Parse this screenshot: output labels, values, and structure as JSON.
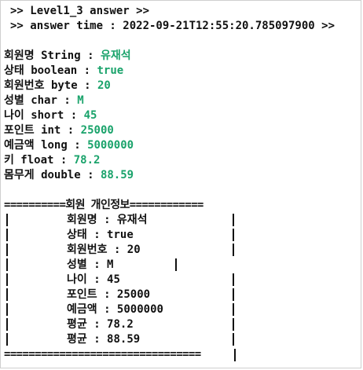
{
  "header": {
    "level": ">> Level1_3 answer >>",
    "time": ">> answer time : 2022-09-21T12:55:20.785097900 >>"
  },
  "fields": [
    {
      "label": "회원명 String : ",
      "value": "유재석"
    },
    {
      "label": "상태 boolean : ",
      "value": "true"
    },
    {
      "label": "회원번호 byte : ",
      "value": "20"
    },
    {
      "label": "성별 char : ",
      "value": "M"
    },
    {
      "label": "나이 short : ",
      "value": "45"
    },
    {
      "label": "포인트 int : ",
      "value": "25000"
    },
    {
      "label": "예금액 long : ",
      "value": "5000000"
    },
    {
      "label": "키 float : ",
      "value": "78.2"
    },
    {
      "label": "몸무게 double : ",
      "value": "88.59"
    }
  ],
  "box": {
    "top": "==========회원 개인정보============",
    "rows": [
      "회원명 : 유재석",
      "상태 : true",
      "회원번호 : 20",
      "성별 : M",
      "나이 : 45",
      "포인트 : 25000",
      "예금액 : 5000000",
      "평균 : 78.2",
      "평균 : 88.59"
    ],
    "bottom": "================================"
  },
  "colors": {
    "value": "#1aa36b",
    "text": "#111111"
  }
}
